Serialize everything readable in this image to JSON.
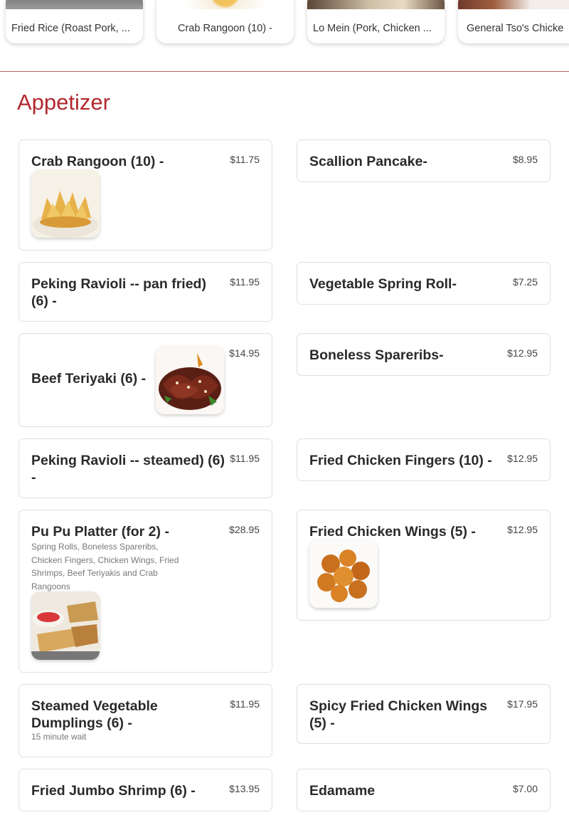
{
  "carousel": {
    "items": [
      {
        "label": "Fried Rice (Roast Pork, ...",
        "color": "#8a8a8a"
      },
      {
        "label": "Crab Rangoon (10) -",
        "color": "#e4b04a"
      },
      {
        "label": "Lo Mein (Pork, Chicken ...",
        "color": "#6b5a4a"
      },
      {
        "label": "General Tso's Chicke",
        "color": "#7a3b2a"
      }
    ]
  },
  "section": {
    "title": "Appetizer"
  },
  "colors": {
    "accent": "#b3282d"
  },
  "items": [
    {
      "name": "Crab Rangoon (10) -",
      "price": "$11.75",
      "thumb": "crab-rangoon-photo"
    },
    {
      "name": "Scallion Pancake-",
      "price": "$8.95"
    },
    {
      "name": "Peking Ravioli -- pan fried) (6) -",
      "price": "$11.95"
    },
    {
      "name": "Vegetable Spring Roll-",
      "price": "$7.25"
    },
    {
      "name": "Beef Teriyaki (6) -",
      "price": "$14.95",
      "thumb": "beef-teriyaki-photo"
    },
    {
      "name": "Boneless Spareribs-",
      "price": "$12.95"
    },
    {
      "name": "Peking Ravioli -- steamed) (6) -",
      "price": "$11.95"
    },
    {
      "name": "Fried Chicken Fingers (10) -",
      "price": "$12.95"
    },
    {
      "name": "Pu Pu Platter (for 2) -",
      "price": "$28.95",
      "description": "Spring Rolls, Boneless Spareribs, Chicken Fingers, Chicken Wings, Fried Shrimps, Beef Teriyakis and Crab Rangoons",
      "thumb": "pu-pu-platter-photo"
    },
    {
      "name": "Fried Chicken Wings (5) -",
      "price": "$12.95",
      "thumb": "chicken-wings-photo"
    },
    {
      "name": "Steamed Vegetable Dumplings (6) -",
      "price": "$11.95",
      "description": "15 minute wait"
    },
    {
      "name": "Spicy Fried Chicken Wings (5) -",
      "price": "$17.95"
    },
    {
      "name": "Fried Jumbo Shrimp (6) -",
      "price": "$13.95"
    },
    {
      "name": "Edamame",
      "price": "$7.00"
    }
  ]
}
